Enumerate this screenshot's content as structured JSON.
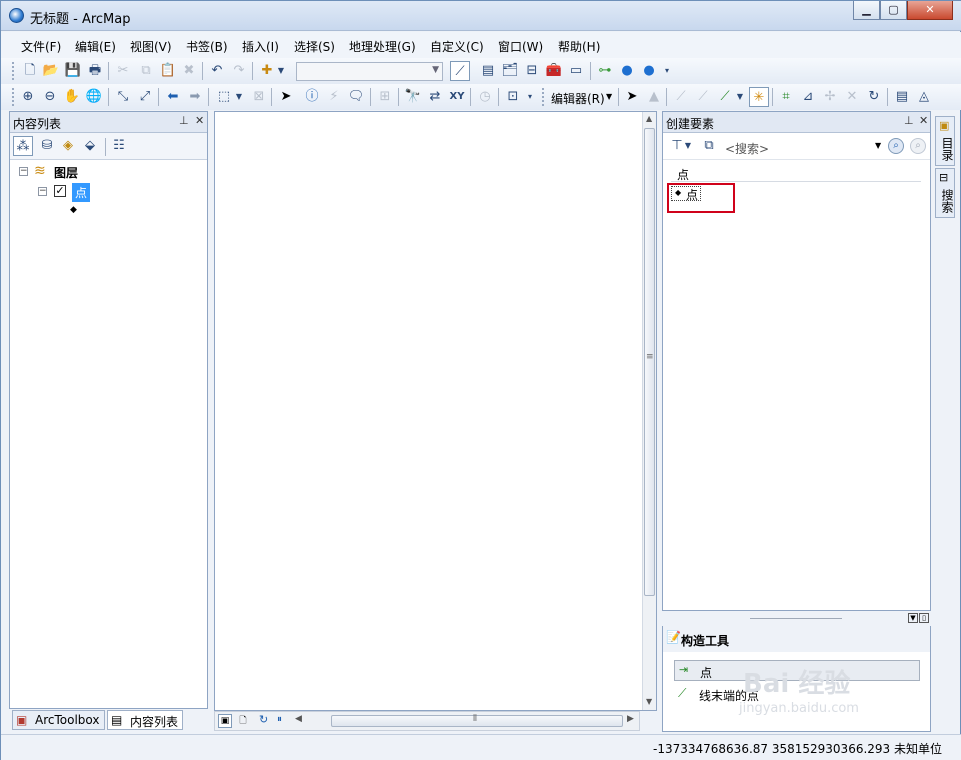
{
  "window": {
    "title": "无标题 - ArcMap"
  },
  "menu": [
    "文件(F)",
    "编辑(E)",
    "视图(V)",
    "书签(B)",
    "插入(I)",
    "选择(S)",
    "地理处理(G)",
    "自定义(C)",
    "窗口(W)",
    "帮助(H)"
  ],
  "toolbar2": {
    "editor_label": "编辑器(R)"
  },
  "toc": {
    "title": "内容列表",
    "root_label": "图层",
    "layer_label": "点"
  },
  "bottom_tabs": {
    "arctoolbox": "ArcToolbox",
    "toc": "内容列表"
  },
  "create_features": {
    "title": "创建要素",
    "search_placeholder": "<搜索>",
    "group_label": "点",
    "template_label": "点"
  },
  "construction_tools": {
    "title": "构造工具",
    "items": [
      "点",
      "线末端的点"
    ]
  },
  "side_tabs": {
    "catalog": "目录",
    "search": "搜索"
  },
  "status": {
    "coordinates": "-137334768636.87  358152930366.293 未知单位"
  },
  "watermark": {
    "brand": "Bai 经验",
    "url": "jingyan.baidu.com"
  },
  "colors": {
    "highlight_box": "#d0021b",
    "selection": "#3399ff"
  }
}
